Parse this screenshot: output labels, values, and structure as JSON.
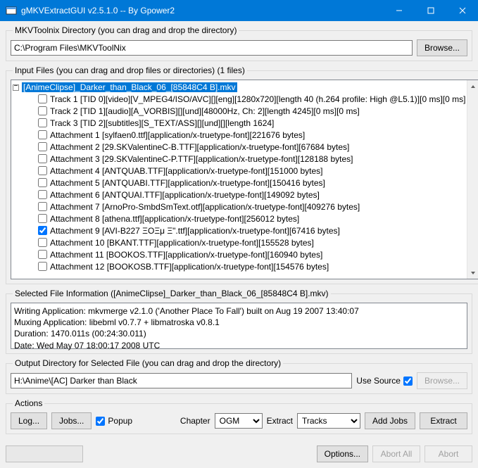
{
  "window": {
    "title": "gMKVExtractGUI v2.5.1.0 -- By Gpower2"
  },
  "toolnix": {
    "legend": "MKVToolnix Directory (you can drag and drop the directory)",
    "path": "C:\\Program Files\\MKVToolNix",
    "browse": "Browse..."
  },
  "input": {
    "legend": "Input Files (you can drag and drop files or directories) (1 files)",
    "root": "[AnimeClipse]_Darker_than_Black_06_[85848C4 B].mkv",
    "items": [
      {
        "checked": false,
        "label": "Track 1 [TID 0][video][V_MPEG4/ISO/AVC][][eng][1280x720][length 40 (h.264 profile: High @L5.1)][0 ms][0 ms]"
      },
      {
        "checked": false,
        "label": "Track 2 [TID 1][audio][A_VORBIS][][und][48000Hz, Ch: 2][length 4245][0 ms][0 ms]"
      },
      {
        "checked": false,
        "label": "Track 3 [TID 2][subtitles][S_TEXT/ASS][][und][][length 1624]"
      },
      {
        "checked": false,
        "label": "Attachment 1 [sylfaen0.ttf][application/x-truetype-font][221676 bytes]"
      },
      {
        "checked": false,
        "label": "Attachment 2 [29.SKValentineC-B.TTF][application/x-truetype-font][67684 bytes]"
      },
      {
        "checked": false,
        "label": "Attachment 3 [29.SKValentineC-P.TTF][application/x-truetype-font][128188 bytes]"
      },
      {
        "checked": false,
        "label": "Attachment 4 [ANTQUAB.TTF][application/x-truetype-font][151000 bytes]"
      },
      {
        "checked": false,
        "label": "Attachment 5 [ANTQUABI.TTF][application/x-truetype-font][150416 bytes]"
      },
      {
        "checked": false,
        "label": "Attachment 6 [ANTQUAI.TTF][application/x-truetype-font][149092 bytes]"
      },
      {
        "checked": false,
        "label": "Attachment 7 [ArnoPro-SmbdSmText.otf][application/x-truetype-font][409276 bytes]"
      },
      {
        "checked": false,
        "label": "Attachment 8 [athena.ttf][application/x-truetype-font][256012 bytes]"
      },
      {
        "checked": true,
        "label": "Attachment 9 [AVI-B227 ΞΟΞμ Ξ\".ttf][application/x-truetype-font][67416 bytes]"
      },
      {
        "checked": false,
        "label": "Attachment 10 [BKANT.TTF][application/x-truetype-font][155528 bytes]"
      },
      {
        "checked": false,
        "label": "Attachment 11 [BOOKOS.TTF][application/x-truetype-font][160940 bytes]"
      },
      {
        "checked": false,
        "label": "Attachment 12 [BOOKOSB.TTF][application/x-truetype-font][154576 bytes]"
      }
    ]
  },
  "info": {
    "legend": "Selected File Information ([AnimeClipse]_Darker_than_Black_06_[85848C4 B].mkv)",
    "line1": "Writing Application: mkvmerge v2.1.0 ('Another Place To Fall') built on Aug 19 2007 13:40:07",
    "line2": "Muxing Application: libebml v0.7.7 + libmatroska v0.8.1",
    "line3": "Duration: 1470.011s (00:24:30.011)",
    "line4": "Date: Wed May 07 18:00:17 2008 UTC"
  },
  "output": {
    "legend": "Output Directory for Selected File (you can drag and drop the directory)",
    "path": "H:\\Anime\\[AC] Darker than Black",
    "use_source": "Use Source",
    "browse": "Browse..."
  },
  "actions": {
    "legend": "Actions",
    "log": "Log...",
    "jobs": "Jobs...",
    "popup": "Popup",
    "chapter_label": "Chapter",
    "chapter_value": "OGM",
    "extract_label": "Extract",
    "extract_value": "Tracks",
    "add_jobs": "Add Jobs",
    "extract": "Extract"
  },
  "bottom": {
    "options": "Options...",
    "abort_all": "Abort All",
    "abort": "Abort"
  }
}
